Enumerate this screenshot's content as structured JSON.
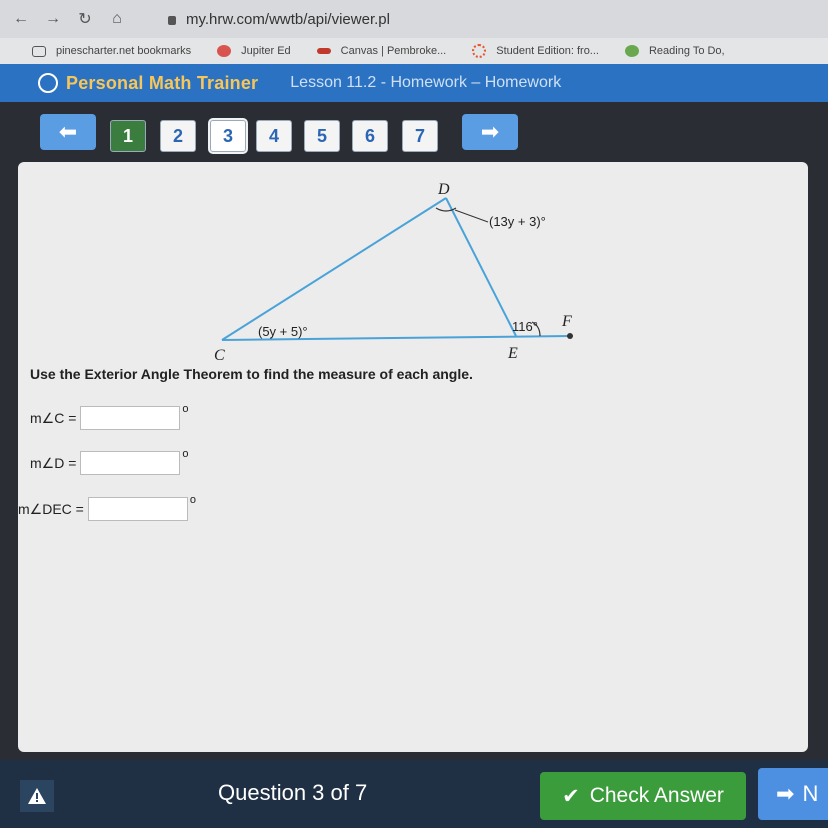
{
  "browser": {
    "url": "my.hrw.com/wwtb/api/viewer.pl",
    "bookmarks": [
      {
        "label": "pinescharter.net bookmarks",
        "icon": "folder-icon",
        "color": "#555555"
      },
      {
        "label": "Jupiter Ed",
        "icon": "jupiter-icon",
        "color": "#d9534f"
      },
      {
        "label": "Canvas | Pembroke...",
        "icon": "canvas-icon",
        "color": "#c0392b"
      },
      {
        "label": "Student Edition: fro...",
        "icon": "student-edition-icon",
        "color": "#e4572e"
      },
      {
        "label": "Reading To Do,",
        "icon": "reading-icon",
        "color": "#6aa84f"
      }
    ]
  },
  "app": {
    "brand": "Personal Math Trainer",
    "lesson": "Lesson 11.2 - Homework – Homework"
  },
  "question_nav": {
    "prev_icon": "arrow-left-icon",
    "next_icon": "arrow-right-icon",
    "numbers": [
      "1",
      "2",
      "3",
      "4",
      "5",
      "6",
      "7"
    ]
  },
  "diagram": {
    "vertices": {
      "C": "C",
      "D": "D",
      "E": "E",
      "F": "F"
    },
    "angle_C": "(5y + 5)°",
    "angle_D": "(13y + 3)°",
    "angle_exterior": "116°"
  },
  "problem": {
    "instruction": "Use the Exterior Angle Theorem to find the measure of each angle.",
    "rows": [
      {
        "label": "m∠C =",
        "value": "",
        "unit": "o"
      },
      {
        "label": "m∠D =",
        "value": "",
        "unit": "o"
      },
      {
        "label": "m∠DEC =",
        "value": "",
        "unit": "o"
      }
    ]
  },
  "footer": {
    "question_count": "Question 3 of 7",
    "check_label": "Check Answer",
    "next_label": "N"
  },
  "colors": {
    "header_blue": "#2b72c2",
    "brand_gold": "#f6c65a",
    "check_green": "#3b9c3c",
    "triangle_line": "#4aa3d8"
  }
}
